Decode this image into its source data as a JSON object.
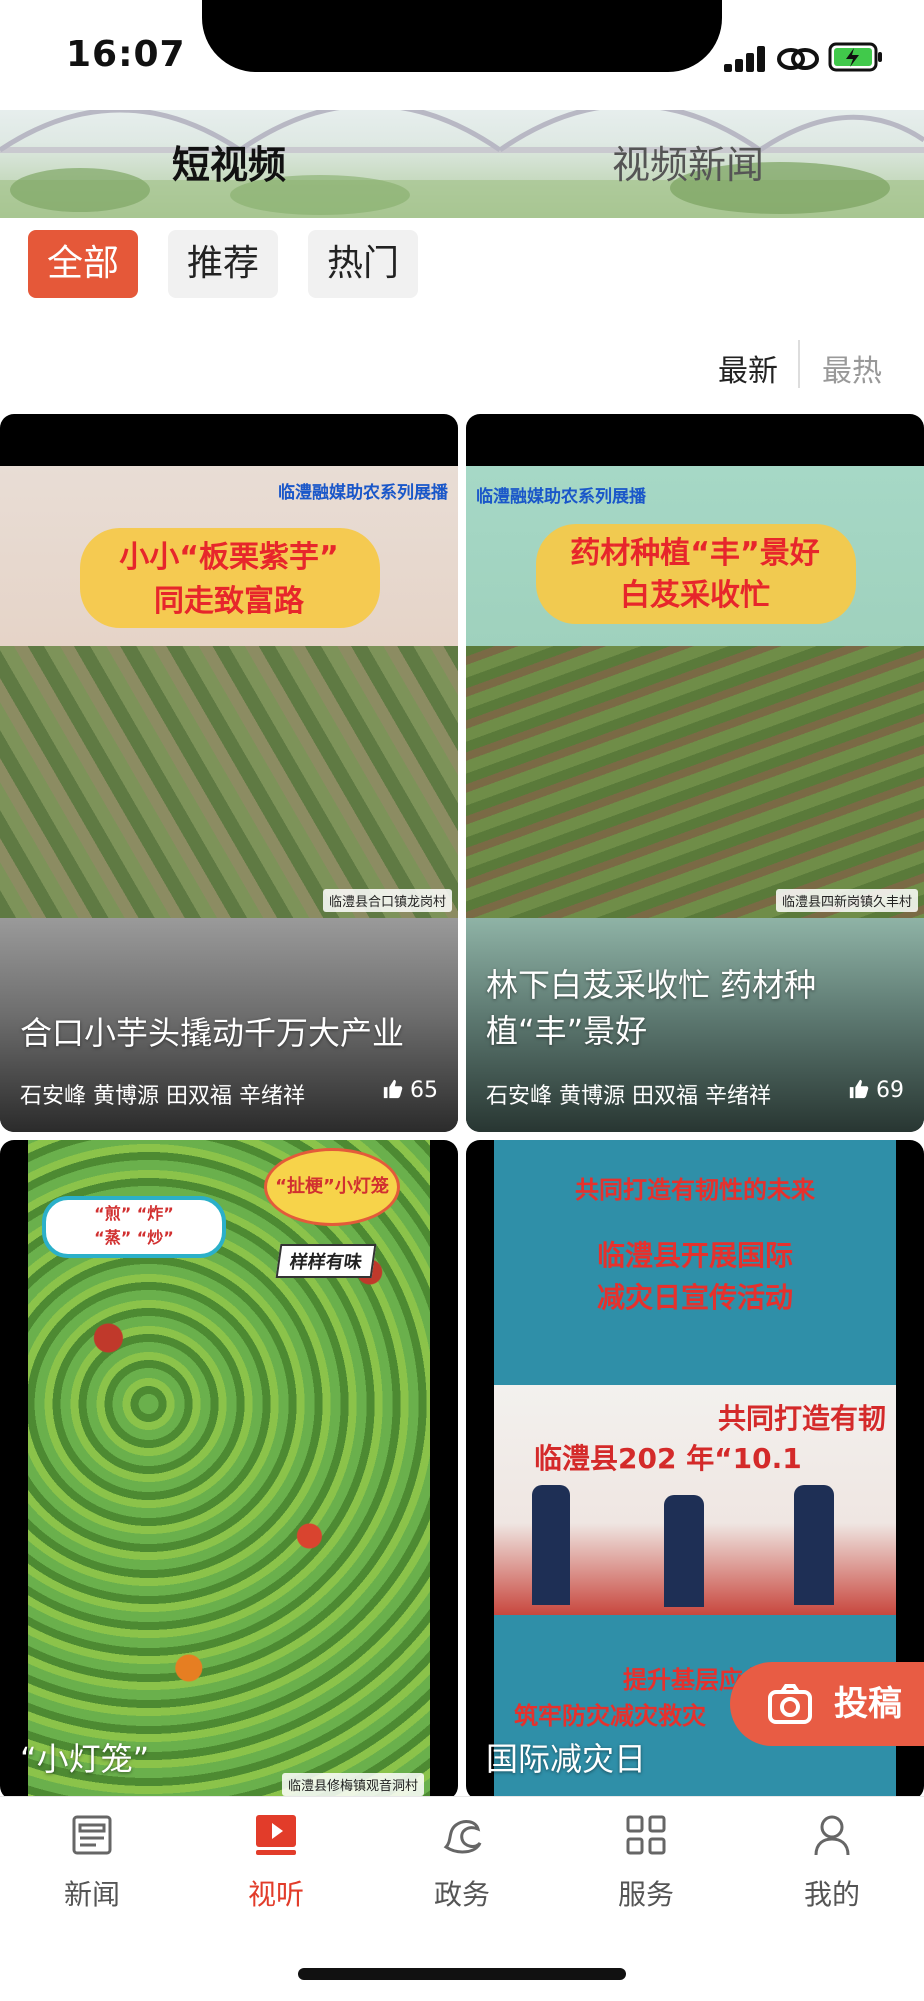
{
  "status_bar": {
    "time": "16:07"
  },
  "header": {
    "tabs": [
      {
        "label": "短视频",
        "active": true
      },
      {
        "label": "视频新闻",
        "active": false
      }
    ]
  },
  "filters": {
    "all": "全部",
    "recommended": "推荐",
    "hot": "热门",
    "active": "全部"
  },
  "sort": {
    "latest": "最新",
    "hottest": "最热",
    "active": "最新"
  },
  "videos": [
    {
      "title": "合口小芋头撬动千万大产业",
      "authors": "石安峰 黄博源 田双福 辛绪祥",
      "likes": "65",
      "cover_series": "临澧融媒助农系列展播",
      "cover_title_line1": "小小“板栗紫芋”",
      "cover_title_line2": "同走致富路",
      "cover_location": "临澧县合口镇龙岗村"
    },
    {
      "title": "林下白芨采收忙 药材种植“丰”景好",
      "authors": "石安峰 黄博源 田双福 辛绪祥",
      "likes": "69",
      "cover_series": "临澧融媒助农系列展播",
      "cover_title_line1": "药材种植“丰”景好",
      "cover_title_line2": "白芨采收忙",
      "cover_location": "临澧县四新岗镇久丰村"
    },
    {
      "title": "“小灯笼”",
      "cover_bubble_line1": "“煎”  “炸”",
      "cover_bubble_line2": "“蒸”  “炒”",
      "cover_burst": "“扯梗”小灯笼",
      "cover_tasty": "样样有味",
      "cover_location": "临澧县修梅镇观音洞村"
    },
    {
      "title": "国际减灾日",
      "cover_headline": "共同打造有韧性的未来",
      "cover_sub_line1": "临澧县开展国际",
      "cover_sub_line2": "减灾日宣传活动",
      "cover_banner_line1": "共同打造有韧",
      "cover_banner_line2": "临澧县202  年“10.1",
      "cover_bottom_line1": "提升基层应急",
      "cover_bottom_line2": "筑牢防灾减灾救灾"
    }
  ],
  "submit_button": {
    "label": "投稿"
  },
  "bottom_nav": [
    {
      "label": "新闻",
      "icon": "news-icon",
      "active": false
    },
    {
      "label": "视听",
      "icon": "video-play-icon",
      "active": true
    },
    {
      "label": "政务",
      "icon": "government-icon",
      "active": false
    },
    {
      "label": "服务",
      "icon": "services-grid-icon",
      "active": false
    },
    {
      "label": "我的",
      "icon": "profile-icon",
      "active": false
    }
  ],
  "colors": {
    "accent": "#e55839",
    "nav_active": "#e23c2a",
    "cover_red": "#e7262b"
  }
}
